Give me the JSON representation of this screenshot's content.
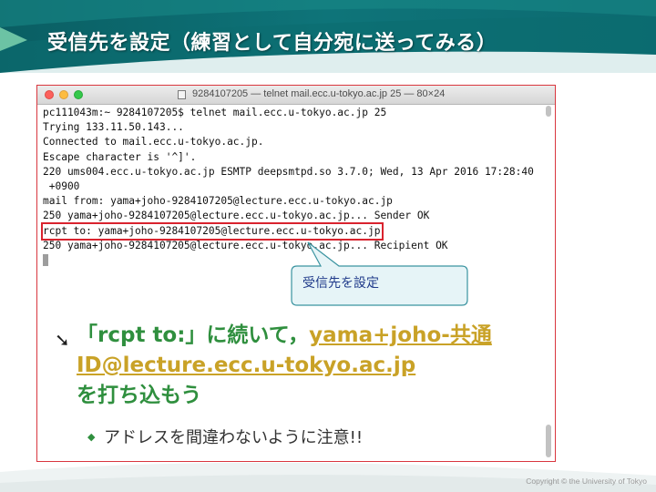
{
  "slide": {
    "title": "受信先を設定（練習として自分宛に送ってみる）",
    "copyright": "Copyright © the University of Tokyo"
  },
  "terminal": {
    "window_title": "9284107205 — telnet mail.ecc.u-tokyo.ac.jp 25 — 80×24",
    "lines": [
      "pc111043m:~ 9284107205$ telnet mail.ecc.u-tokyo.ac.jp 25",
      "Trying 133.11.50.143...",
      "Connected to mail.ecc.u-tokyo.ac.jp.",
      "Escape character is '^]'.",
      "220 ums004.ecc.u-tokyo.ac.jp ESMTP deepsmtpd.so 3.7.0; Wed, 13 Apr 2016 17:28:40",
      " +0900",
      "mail from: yama+joho-9284107205@lecture.ecc.u-tokyo.ac.jp",
      "250 yama+joho-9284107205@lecture.ecc.u-tokyo.ac.jp... Sender OK",
      "rcpt to: yama+joho-9284107205@lecture.ecc.u-tokyo.ac.jp",
      "250 yama+joho-9284107205@lecture.ecc.u-tokyo.ac.jp... Recipient OK"
    ],
    "highlighted_line_index": 8
  },
  "callout": {
    "text": "受信先を設定"
  },
  "bullet": {
    "part1": "「rcpt to:」に続いて，",
    "part2": "yama+joho-共通ID@lecture.ecc.u-tokyo.ac.jp",
    "part3": "を打ち込もう"
  },
  "sub_bullet": {
    "text": "アドレスを間違わないように注意!!"
  },
  "colors": {
    "header_teal": "#0e6f73",
    "accent_green": "#2f8f3e",
    "highlight_gold": "#c9a227",
    "frame_red": "#d9363e",
    "callout_fill": "#e6f4f7"
  }
}
